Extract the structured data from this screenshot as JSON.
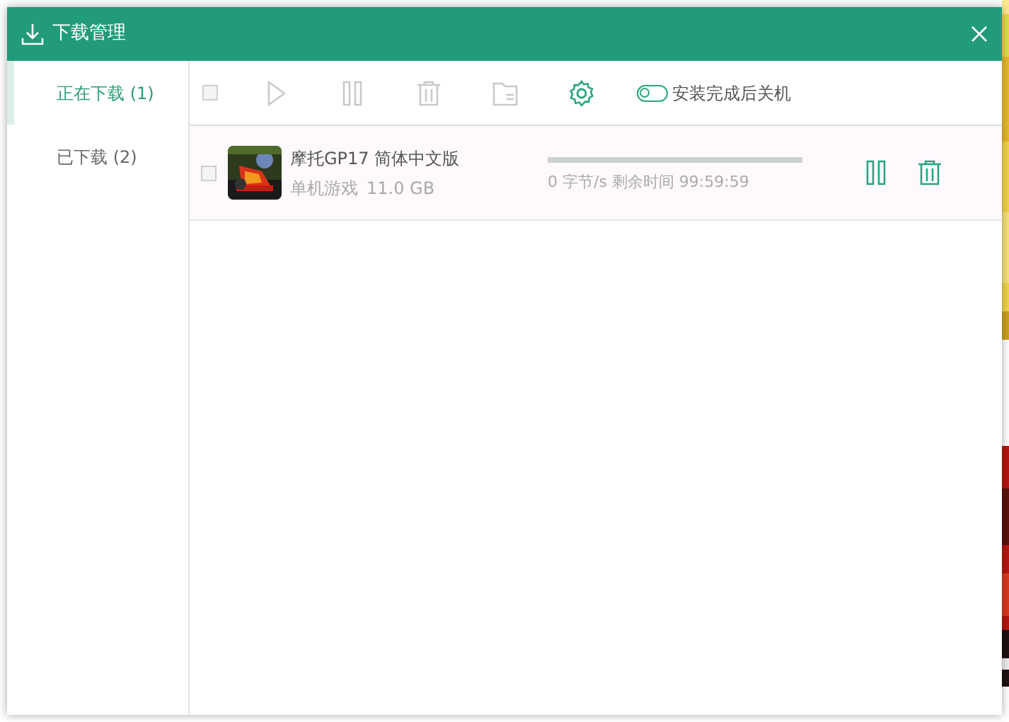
{
  "window": {
    "title": "下载管理"
  },
  "tabs": [
    {
      "label": "正在下载 (1)",
      "selected": true
    },
    {
      "label": "已下载 (2)",
      "selected": false
    }
  ],
  "toolbar": {
    "select_all_checked": false,
    "buttons": [
      {
        "kind": "play",
        "disabled": true
      },
      {
        "kind": "pause",
        "disabled": true
      },
      {
        "kind": "delete",
        "disabled": true
      },
      {
        "kind": "folder",
        "disabled": true
      },
      {
        "kind": "settings",
        "disabled": false
      }
    ],
    "shutdown_toggle": {
      "label": "安装完成后关机",
      "on": false
    }
  },
  "downloads": [
    {
      "checked": false,
      "title": "摩托GP17 简体中文版",
      "category": "单机游戏",
      "size": "11.0 GB",
      "level": 0,
      "status": "0 字节/s 剩余时间 99:59:59",
      "actions": [
        {
          "kind": "pause"
        },
        {
          "kind": "delete"
        }
      ]
    }
  ]
}
